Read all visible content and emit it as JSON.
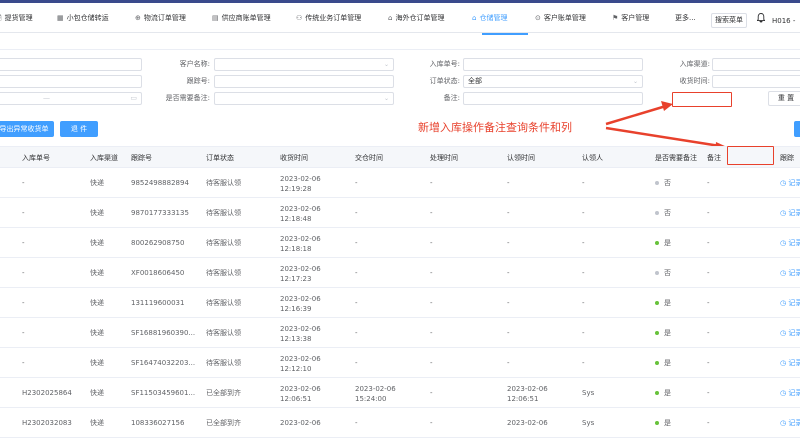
{
  "nav": {
    "items": [
      {
        "icon": "🗎",
        "label": "提货管理"
      },
      {
        "icon": "▦",
        "label": "小包仓储转运"
      },
      {
        "icon": "⊕",
        "label": "物流订单管理"
      },
      {
        "icon": "▤",
        "label": "供应商账单管理"
      },
      {
        "icon": "⚇",
        "label": "传统业务订单管理"
      },
      {
        "icon": "⌂",
        "label": "海外仓订单管理"
      },
      {
        "icon": "⌂",
        "label": "仓储管理"
      },
      {
        "icon": "⊙",
        "label": "客户账单管理"
      },
      {
        "icon": "⚑",
        "label": "客户管理"
      },
      {
        "label": "更多..."
      }
    ],
    "search_menu": "搜索菜单",
    "bell_icon": "bell-icon",
    "user": "H016 -"
  },
  "filters": {
    "customer_name_label": "客户名称:",
    "tracking_no_label": "跟踪号:",
    "need_remark_label": "是否需要备注:",
    "inbound_no_label": "入库单号:",
    "order_status_label": "订单状态:",
    "order_status_value": "全部",
    "remark_label": "备注:",
    "inbound_channel_label": "入库渠道:",
    "receive_time_label": "收货时间:",
    "date_sep": "—",
    "reset": "重 置"
  },
  "actions": {
    "export_abnormal": "导出异常收货单",
    "return": "退 件"
  },
  "annotation": "新增入库操作备注查询条件和列",
  "table": {
    "headers": [
      "入库单号",
      "入库渠道",
      "跟踪号",
      "订单状态",
      "收货时间",
      "交仓时间",
      "处理时间",
      "认领时间",
      "认领人",
      "是否需要备注",
      "备注",
      "跟踪"
    ],
    "rows": [
      {
        "inbound": "-",
        "channel": "快递",
        "tracking": "9852498882894",
        "status": "待客服认领",
        "recv_date": "2023-02-06",
        "recv_time": "12:19:28",
        "hand_date": "-",
        "hand_time": "",
        "proc": "-",
        "claim_date": "-",
        "claim_time": "",
        "claimer": "-",
        "need": "否",
        "need_color": "grey",
        "remark": "-",
        "track": "记录"
      },
      {
        "inbound": "-",
        "channel": "快递",
        "tracking": "9870177333135",
        "status": "待客服认领",
        "recv_date": "2023-02-06",
        "recv_time": "12:18:48",
        "hand_date": "-",
        "hand_time": "",
        "proc": "-",
        "claim_date": "-",
        "claim_time": "",
        "claimer": "-",
        "need": "否",
        "need_color": "grey",
        "remark": "-",
        "track": "记录"
      },
      {
        "inbound": "-",
        "channel": "快递",
        "tracking": "800262908750",
        "status": "待客服认领",
        "recv_date": "2023-02-06",
        "recv_time": "12:18:18",
        "hand_date": "-",
        "hand_time": "",
        "proc": "-",
        "claim_date": "-",
        "claim_time": "",
        "claimer": "-",
        "need": "是",
        "need_color": "green",
        "remark": "-",
        "track": "记录"
      },
      {
        "inbound": "-",
        "channel": "快递",
        "tracking": "XF0018606450",
        "status": "待客服认领",
        "recv_date": "2023-02-06",
        "recv_time": "12:17:23",
        "hand_date": "-",
        "hand_time": "",
        "proc": "-",
        "claim_date": "-",
        "claim_time": "",
        "claimer": "-",
        "need": "否",
        "need_color": "grey",
        "remark": "-",
        "track": "记录"
      },
      {
        "inbound": "-",
        "channel": "快递",
        "tracking": "131119600031",
        "status": "待客服认领",
        "recv_date": "2023-02-06",
        "recv_time": "12:16:39",
        "hand_date": "-",
        "hand_time": "",
        "proc": "-",
        "claim_date": "-",
        "claim_time": "",
        "claimer": "-",
        "need": "是",
        "need_color": "green",
        "remark": "-",
        "track": "记录"
      },
      {
        "inbound": "-",
        "channel": "快递",
        "tracking": "SF16881960390...",
        "status": "待客服认领",
        "recv_date": "2023-02-06",
        "recv_time": "12:13:38",
        "hand_date": "-",
        "hand_time": "",
        "proc": "-",
        "claim_date": "-",
        "claim_time": "",
        "claimer": "-",
        "need": "是",
        "need_color": "green",
        "remark": "-",
        "track": "记录"
      },
      {
        "inbound": "-",
        "channel": "快递",
        "tracking": "SF16474032203...",
        "status": "待客服认领",
        "recv_date": "2023-02-06",
        "recv_time": "12:12:10",
        "hand_date": "-",
        "hand_time": "",
        "proc": "-",
        "claim_date": "-",
        "claim_time": "",
        "claimer": "-",
        "need": "是",
        "need_color": "green",
        "remark": "-",
        "track": "记录"
      },
      {
        "inbound": "H2302025864",
        "channel": "快递",
        "tracking": "SF11503459601...",
        "status": "已全部到齐",
        "recv_date": "2023-02-06",
        "recv_time": "12:06:51",
        "hand_date": "2023-02-06",
        "hand_time": "15:24:00",
        "proc": "-",
        "claim_date": "2023-02-06",
        "claim_time": "12:06:51",
        "claimer": "Sys",
        "need": "是",
        "need_color": "green",
        "remark": "-",
        "track": "记录"
      },
      {
        "inbound": "H2302032083",
        "channel": "快递",
        "tracking": "108336027156",
        "status": "已全部到齐",
        "recv_date": "2023-02-06",
        "recv_time": "",
        "hand_date": "-",
        "hand_time": "",
        "proc": "-",
        "claim_date": "2023-02-06",
        "claim_time": "",
        "claimer": "Sys",
        "need": "是",
        "need_color": "green",
        "remark": "-",
        "track": "记录"
      }
    ]
  }
}
